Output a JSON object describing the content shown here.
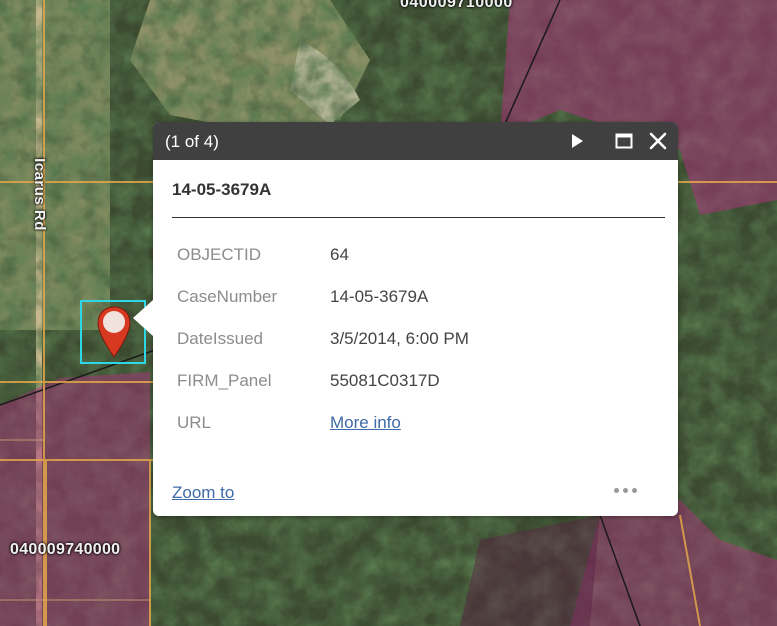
{
  "map": {
    "road_label": "Icarus Rd",
    "parcel_label_top": "040009710000",
    "parcel_label_bottom": "040009740000"
  },
  "popup": {
    "pager": "(1 of 4)",
    "title": "14-05-3679A",
    "fields": [
      {
        "name": "OBJECTID",
        "value": "64"
      },
      {
        "name": "CaseNumber",
        "value": "14-05-3679A"
      },
      {
        "name": "DateIssued",
        "value": "3/5/2014, 6:00 PM"
      },
      {
        "name": "FIRM_Panel",
        "value": "55081C0317D"
      },
      {
        "name": "URL",
        "value": "More info"
      }
    ],
    "zoom_label": "Zoom to",
    "icons": [
      "next-arrow-icon",
      "maximize-icon",
      "close-icon",
      "more-options-icon"
    ]
  },
  "colors": {
    "header": "#404040",
    "selection": "#2fd7e6",
    "pin": "#d6391f",
    "flood_zone": "#a8347a",
    "link": "#3f6aa8"
  }
}
